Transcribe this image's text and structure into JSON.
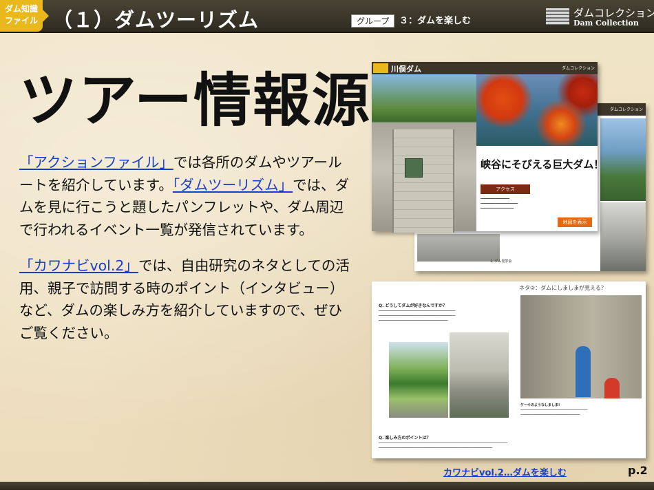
{
  "header": {
    "badge_line1": "ダム知識",
    "badge_line2": "ファイル",
    "title": "（１）ダムツーリズム",
    "group_label": "グループ",
    "group_value": "３：ダムを楽しむ",
    "logo_jp": "ダムコレクション",
    "logo_en": "Dam Collection"
  },
  "main": {
    "heading": "ツアー情報源",
    "p1_link1": "「アクションファイル」",
    "p1_text1": "では各所のダムやツアールートを紹介しています。",
    "p1_link2": "「ダムツーリズム」",
    "p1_text2": "では、ダムを見に行こうと題したパンフレットや、ダム周辺で行われるイベント一覧が発信されています。",
    "p2_link": "「カワナビvol.2」",
    "p2_text": "では、自由研究のネタとしての活用、親子で訪問する時のポイント（インタビュー）など、ダムの楽しみ方を紹介していますので、ぜひご覧ください。"
  },
  "shots": {
    "front_name": "川俣ダム",
    "front_catch": "峡谷にそびえる巨大ダム！",
    "front_access": "アクセス",
    "front_map": "地図を表示",
    "front_logo": "ダムコレクション",
    "back_logo": "ダムコレクション",
    "back_caption": "1. ダム見学会",
    "qa_heading": "ネタ②：ダムにしましまが見える？",
    "qa_q1": "Q. どうしてダムが好きなんですか？",
    "qa_q2": "Q. 楽しみ方のポイントは？",
    "qa_cap": "ケーキのようなしましま!"
  },
  "footer": {
    "link": "カワナビvol.2…ダムを楽しむ",
    "page": "p.2"
  },
  "colors": {
    "accent": "#e8b81c",
    "header_bg": "#3a3428",
    "link": "#1a3fc7"
  }
}
